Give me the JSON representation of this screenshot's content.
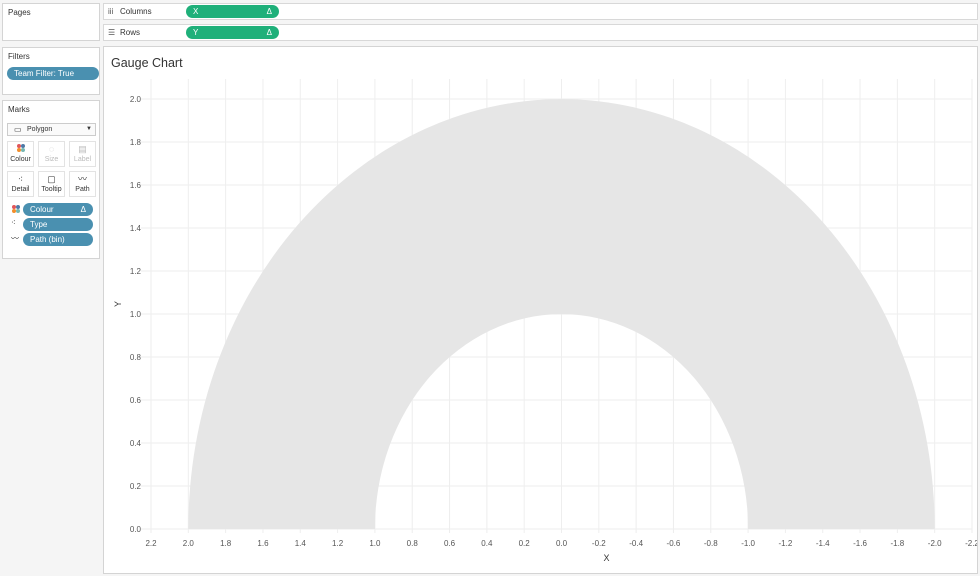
{
  "pages": {
    "title": "Pages"
  },
  "filters": {
    "title": "Filters",
    "items": [
      "Team Filter: True"
    ]
  },
  "marks": {
    "title": "Marks",
    "mark_type": "Polygon",
    "buttons": [
      {
        "label": "Colour",
        "icon": "colour-icon",
        "enabled": true
      },
      {
        "label": "Size",
        "icon": "size-icon",
        "enabled": false
      },
      {
        "label": "Label",
        "icon": "label-icon",
        "enabled": false
      },
      {
        "label": "Detail",
        "icon": "detail-icon",
        "enabled": true
      },
      {
        "label": "Tooltip",
        "icon": "tooltip-icon",
        "enabled": true
      },
      {
        "label": "Path",
        "icon": "path-icon",
        "enabled": true
      }
    ],
    "fields": [
      {
        "label": "Colour",
        "suffix": "Δ",
        "icon": "colour-icon"
      },
      {
        "label": "Type",
        "suffix": "",
        "icon": "detail-icon"
      },
      {
        "label": "Path (bin)",
        "suffix": "",
        "icon": "path-icon"
      }
    ]
  },
  "shelves": {
    "columns": {
      "label": "Columns",
      "pill": "X",
      "suffix": "Δ",
      "icon": "columns-icon"
    },
    "rows": {
      "label": "Rows",
      "pill": "Y",
      "suffix": "Δ",
      "icon": "rows-icon"
    }
  },
  "colors": {
    "pill_green": "#1fb07a",
    "pill_blue": "#4a90b0",
    "arc_fill": "#e6e6e6",
    "grid": "#eeeeee"
  },
  "chart_data": {
    "type": "area",
    "title": "Gauge Chart",
    "xlabel": "X",
    "ylabel": "Y",
    "x_reversed": true,
    "xlim": [
      2.2,
      -2.2
    ],
    "ylim": [
      0.0,
      2.0
    ],
    "x_ticks": [
      2.2,
      2.0,
      1.8,
      1.6,
      1.4,
      1.2,
      1.0,
      0.8,
      0.6,
      0.4,
      0.2,
      0.0,
      -0.2,
      -0.4,
      -0.6,
      -0.8,
      -1.0,
      -1.2,
      -1.4,
      -1.6,
      -1.8,
      -2.0,
      -2.2
    ],
    "x_tick_labels": [
      "2.2",
      "2.0",
      "1.8",
      "1.6",
      "1.4",
      "1.2",
      "1.0",
      "0.8",
      "0.6",
      "0.4",
      "0.2",
      "0.0",
      "-0.2",
      "-0.4",
      "-0.6",
      "-0.8",
      "-1.0",
      "-1.2",
      "-1.4",
      "-1.6",
      "-1.8",
      "-2.0",
      "-2.2"
    ],
    "y_ticks": [
      0.0,
      0.2,
      0.4,
      0.6,
      0.8,
      1.0,
      1.2,
      1.4,
      1.6,
      1.8,
      2.0
    ],
    "y_tick_labels": [
      "0.0",
      "0.2",
      "0.4",
      "0.6",
      "0.8",
      "1.0",
      "1.2",
      "1.4",
      "1.6",
      "1.8",
      "2.0"
    ],
    "grid": true,
    "shapes": [
      {
        "name": "",
        "kind": "half-annulus",
        "center": [
          0.0,
          0.0
        ],
        "outer_radius": 2.0,
        "inner_radius": 1.0
      }
    ]
  }
}
